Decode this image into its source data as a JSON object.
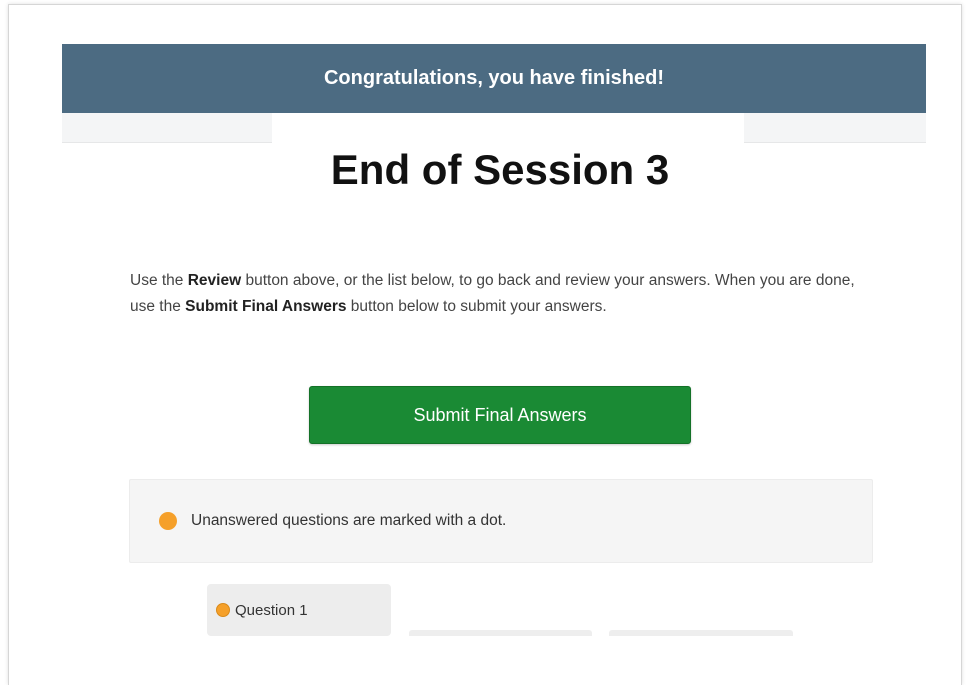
{
  "banner": {
    "text": "Congratulations, you have finished!",
    "color": "#4c6b82"
  },
  "page_title": "End of Session 3",
  "instructions": {
    "part1": "Use the ",
    "review_word": "Review",
    "part2": " button above, or the list below, to go back and review your answers. When you are done, use the ",
    "submit_word": "Submit Final Answers",
    "part3": " button below to submit your answers."
  },
  "submit_button": {
    "label": "Submit Final Answers",
    "color": "#1a8a34"
  },
  "legend": {
    "icon": "orange-dot-icon",
    "text": "Unanswered questions are marked with a dot.",
    "dot_color": "#f5a02a"
  },
  "questions": [
    {
      "label": "Question 1",
      "unanswered": true
    }
  ]
}
